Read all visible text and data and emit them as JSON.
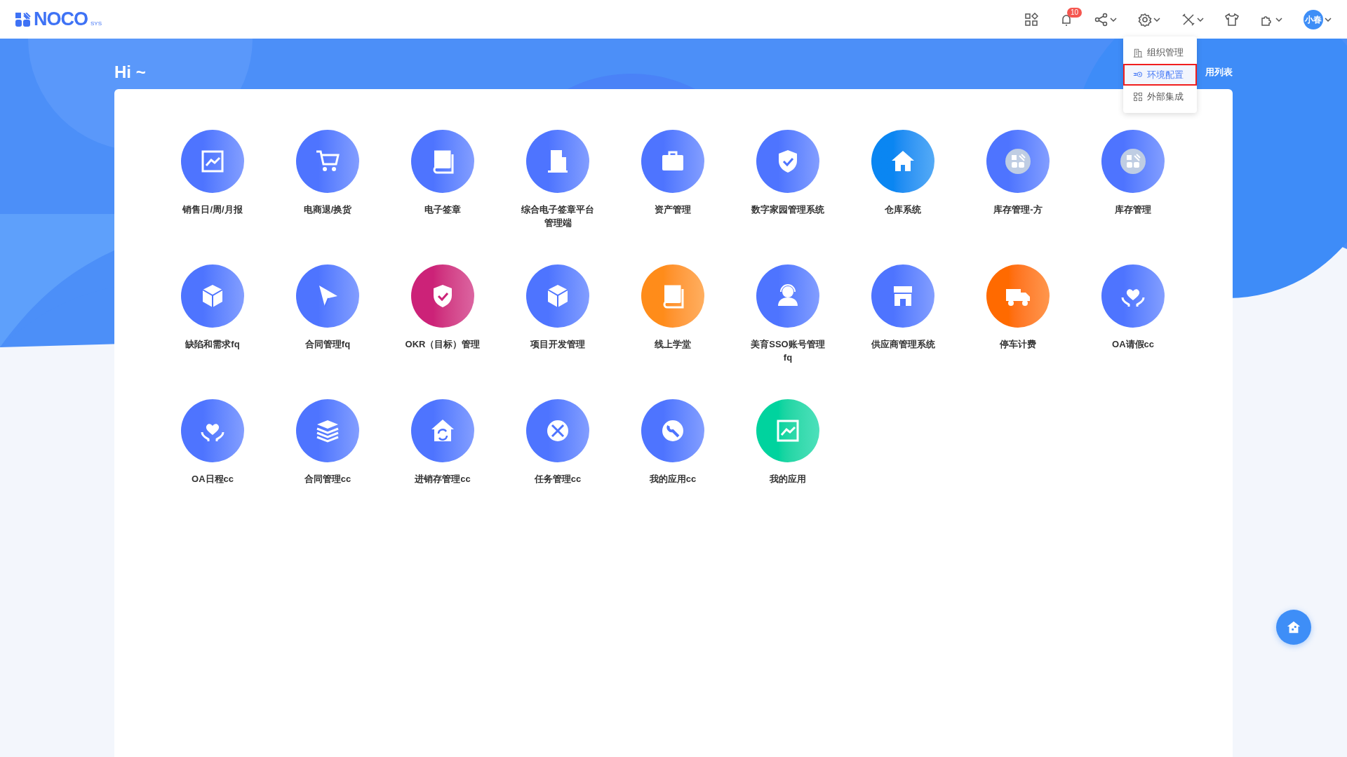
{
  "header": {
    "logo": "NOCO",
    "logo_sup": "SYS",
    "notification_count": "10",
    "avatar_text": "小春"
  },
  "greeting": "Hi ~",
  "app_list_link": "用列表",
  "settings_menu": [
    {
      "label": "组织管理",
      "kind": "org",
      "selected": false
    },
    {
      "label": "环境配置",
      "kind": "env",
      "selected": true
    },
    {
      "label": "外部集成",
      "kind": "integration",
      "selected": false
    }
  ],
  "apps": [
    {
      "name": "销售日/周/月报",
      "kind": "chart",
      "color": "#4e74ff"
    },
    {
      "name": "电商退/换货",
      "kind": "cart",
      "color": "#4e74ff"
    },
    {
      "name": "电子签章",
      "kind": "book",
      "color": "#4e74ff"
    },
    {
      "name": "综合电子签章平台管理端",
      "kind": "building",
      "color": "#4e74ff"
    },
    {
      "name": "资产管理",
      "kind": "briefcase",
      "color": "#4e74ff"
    },
    {
      "name": "数字家园管理系统",
      "kind": "shield",
      "color": "#4e74ff"
    },
    {
      "name": "仓库系统",
      "kind": "home",
      "color": "#0a86f2"
    },
    {
      "name": "库存管理-方",
      "kind": "logo",
      "color": "#4e74ff"
    },
    {
      "name": "库存管理",
      "kind": "logo",
      "color": "#4e74ff"
    },
    {
      "name": "缺陷和需求fq",
      "kind": "cube",
      "color": "#4e74ff"
    },
    {
      "name": "合同管理fq",
      "kind": "plane",
      "color": "#4e74ff"
    },
    {
      "name": "OKR（目标）管理",
      "kind": "shield",
      "color": "#cc2278"
    },
    {
      "name": "项目开发管理",
      "kind": "cube",
      "color": "#4e74ff"
    },
    {
      "name": "线上学堂",
      "kind": "book",
      "color": "#ff8c1a"
    },
    {
      "name": "美育SSO账号管理fq",
      "kind": "person",
      "color": "#4e74ff"
    },
    {
      "name": "供应商管理系统",
      "kind": "store",
      "color": "#4e74ff"
    },
    {
      "name": "停车计费",
      "kind": "truck",
      "color": "#ff6a00"
    },
    {
      "name": "OA请假cc",
      "kind": "heart",
      "color": "#4e74ff"
    },
    {
      "name": "OA日程cc",
      "kind": "heart",
      "color": "#4e74ff"
    },
    {
      "name": "合同管理cc",
      "kind": "layers",
      "color": "#4e74ff"
    },
    {
      "name": "进销存管理cc",
      "kind": "house-refresh",
      "color": "#4e74ff"
    },
    {
      "name": "任务管理cc",
      "kind": "tools",
      "color": "#4e74ff"
    },
    {
      "name": "我的应用cc",
      "kind": "wrench",
      "color": "#4e74ff"
    },
    {
      "name": "我的应用",
      "kind": "chart",
      "color": "#00d39e"
    }
  ]
}
